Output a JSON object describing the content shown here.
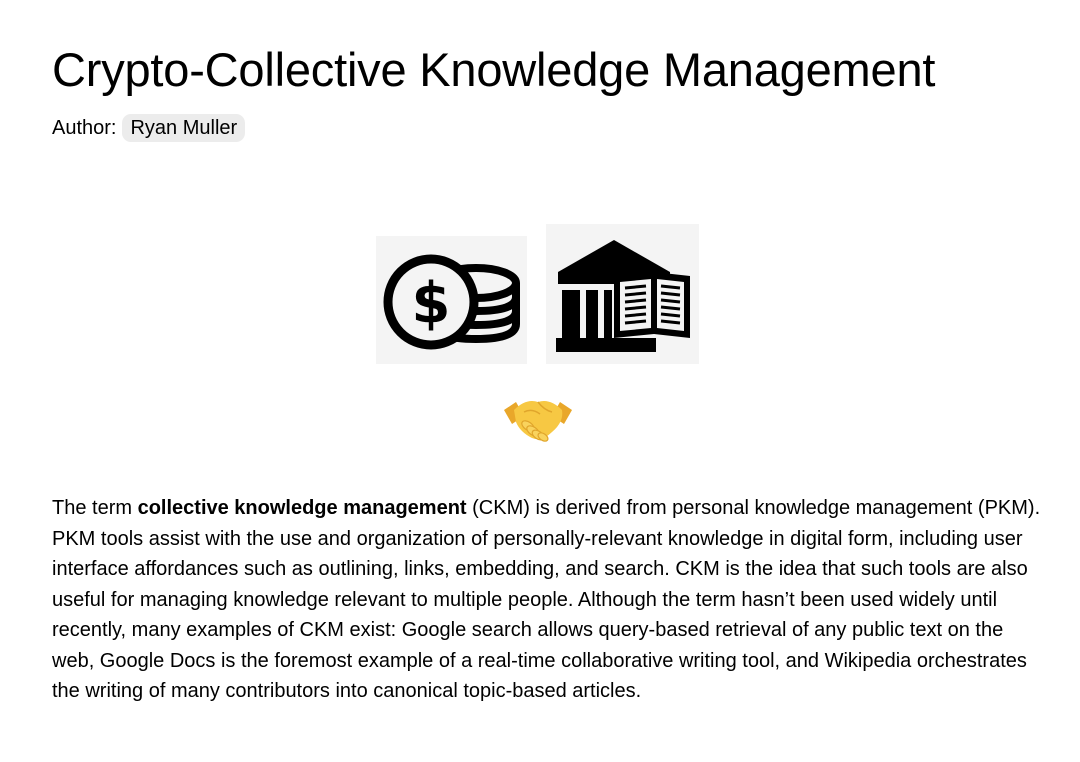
{
  "document": {
    "title": "Crypto-Collective Knowledge Management",
    "author_label": "Author:",
    "author_name": "Ryan Muller"
  },
  "images": {
    "left_icon": "dollar-coins-icon",
    "right_icon": "library-book-icon",
    "center_emoji": "handshake-emoji"
  },
  "body": {
    "intro_text": "The term ",
    "bold_term": "collective knowledge management",
    "remaining_text": " (CKM) is derived from personal knowledge management (PKM). PKM tools assist with the use and organization of personally-relevant knowledge in digital form, including user interface affordances such as outlining, links, embedding, and search. CKM is the idea that such tools are also useful for managing knowledge relevant to multiple people. Although the term hasn’t been used widely until recently, many examples of CKM exist: Google search allows query-based retrieval of any public text on the web, Google Docs is the foremost example of a real-time collaborative writing tool, and Wikipedia orchestrates the writing of many contributors into canonical topic-based articles."
  },
  "colors": {
    "text": "#000000",
    "chip_background": "#ececec",
    "image_background": "#f4f4f4",
    "handshake_fill": "#f7c843"
  }
}
